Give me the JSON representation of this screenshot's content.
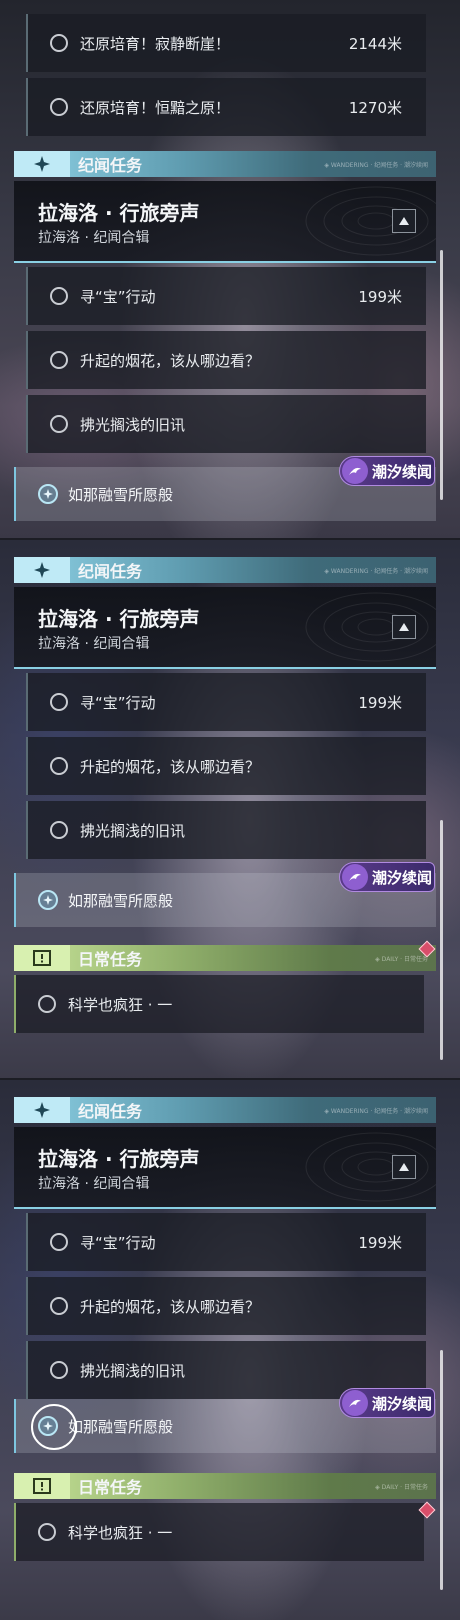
{
  "panel1": {
    "top_items": [
      {
        "label": "还原培育！寂静断崖！",
        "dist": "2144米"
      },
      {
        "label": "还原培育！恒黯之原！",
        "dist": "1270米"
      }
    ]
  },
  "story": {
    "section_title": "纪闻任务",
    "section_fine": "◈ WANDERING · 纪闻任务 · 潮汐续闻",
    "card_title": "拉海洛 · 行旅旁声",
    "card_subtitle": "拉海洛 · 纪闻合辑",
    "quests": [
      {
        "label": "寻“宝”行动",
        "dist": "199米"
      },
      {
        "label": "升起的烟花，该从哪边看？",
        "dist": ""
      },
      {
        "label": "拂光搁浅的旧讯",
        "dist": ""
      }
    ],
    "tracked_label": "如那融雪所愿般",
    "badge_label": "潮汐续闻"
  },
  "daily": {
    "section_title": "日常任务",
    "section_fine": "◈ DAILY · 日常任务",
    "quest_label": "科学也疯狂 · 一"
  },
  "colors": {
    "story_accent": "#8fd2e6",
    "daily_accent": "#c9e59a",
    "badge": "#5a3a8a",
    "gem": "#d84e6a"
  },
  "icons": {
    "section_story": "sparkle-icon",
    "section_daily": "exclamation-box-icon",
    "expand": "triangle-up-icon",
    "badge": "tide-swirl-icon",
    "tracked": "target-sparkle-icon",
    "gem": "diamond-gem-icon"
  }
}
